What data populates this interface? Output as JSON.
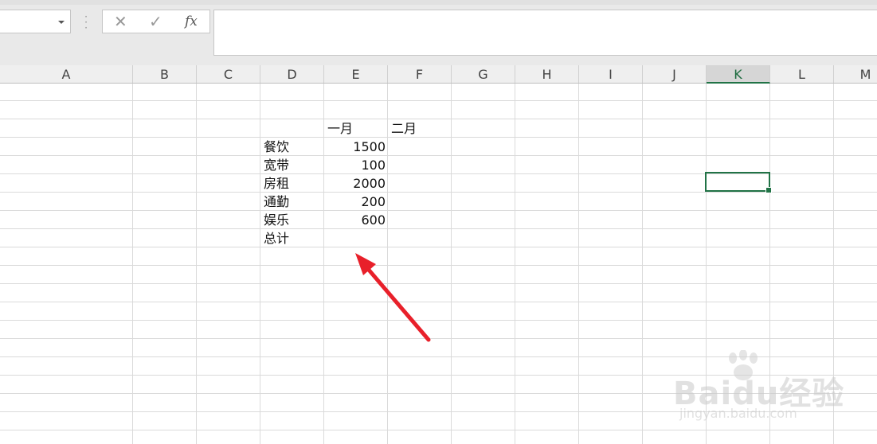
{
  "toolbar": {
    "cancel_icon": "✕",
    "confirm_icon": "✓",
    "function_label": "fx"
  },
  "columns": [
    "A",
    "B",
    "C",
    "D",
    "E",
    "F",
    "G",
    "H",
    "I",
    "J",
    "K",
    "L",
    "M"
  ],
  "active_column": "K",
  "sheet": {
    "headers": {
      "jan": "一月",
      "feb": "二月"
    },
    "rows": [
      {
        "label": "餐饮",
        "jan": "1500"
      },
      {
        "label": "宽带",
        "jan": "100"
      },
      {
        "label": "房租",
        "jan": "2000"
      },
      {
        "label": "通勤",
        "jan": "200"
      },
      {
        "label": "娱乐",
        "jan": "600"
      },
      {
        "label": "总计",
        "jan": ""
      }
    ]
  },
  "watermark": {
    "main": "Baidu经验",
    "sub": "jingyan.baidu.com"
  },
  "colors": {
    "accent": "#217346",
    "arrow": "#e8202a"
  }
}
